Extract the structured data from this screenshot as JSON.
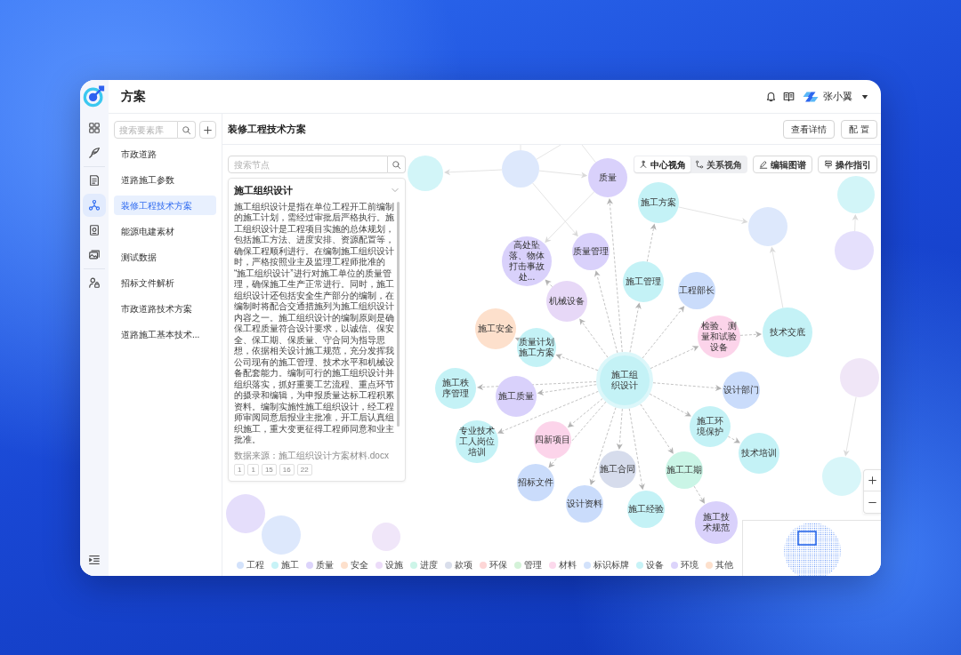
{
  "app": {
    "title": "方案",
    "username": "张小翼"
  },
  "rail": {
    "groups": [
      {
        "items": [
          {
            "selected": false
          },
          {
            "selected": false
          }
        ]
      },
      {
        "items": [
          {
            "selected": false
          },
          {
            "selected": true
          },
          {
            "selected": false
          },
          {
            "selected": false
          }
        ]
      },
      {
        "items": [
          {
            "selected": false
          }
        ]
      }
    ]
  },
  "sidebar": {
    "search": {
      "placeholder": "搜索要素库"
    },
    "items": [
      {
        "label": "市政道路",
        "selected": false
      },
      {
        "label": "道路施工参数",
        "selected": false
      },
      {
        "label": "装修工程技术方案",
        "selected": true
      },
      {
        "label": "能源电建素材",
        "selected": false
      },
      {
        "label": "测试数据",
        "selected": false
      },
      {
        "label": "招标文件解析",
        "selected": false
      },
      {
        "label": "市政道路技术方案",
        "selected": false
      },
      {
        "label": "道路施工基本技术...",
        "selected": false
      }
    ]
  },
  "main": {
    "title": "装修工程技术方案",
    "buttons": [
      "查看详情",
      "配 置"
    ]
  },
  "node_search": {
    "placeholder": "搜索节点"
  },
  "detail": {
    "title": "施工组织设计",
    "text": "施工组织设计是指在单位工程开工前编制的施工计划，需经过审批后严格执行。施工组织设计是工程项目实施的总体规划，包括施工方法、进度安排、资源配置等，确保工程顺利进行。在编制施工组织设计时，严格按照业主及监理工程师批准的“施工组织设计”进行对施工单位的质量管理，确保施工生产正常进行。同时，施工组织设计还包括安全生产部分的编制，在编制时将配合交通措施列为施工组织设计内容之一。施工组织设计的编制原则是确保工程质量符合设计要求，以诚信、保安全、保工期、保质量、守合同为指导思想，依据相关设计施工规范，充分发挥我公司现有的施工管理、技术水平和机械设备配套能力。编制可行的施工组织设计并组织落实，抓好重要工艺流程、重点环节的摄录和编辑，为申报质量达标工程积累资料。编制实施性施工组织设计，经工程师审阅同意后报业主批准，开工后认真组织施工，重大变更征得工程师同意和业主批准。",
    "source": "数据来源：施工组织设计方案材料.docx",
    "pages": [
      "1",
      "1",
      "15",
      "16",
      "22"
    ]
  },
  "view_tabs": [
    {
      "label": "中心视角",
      "selected": true
    },
    {
      "label": "关系视角",
      "selected": false
    }
  ],
  "tools": [
    "编辑图谱",
    "操作指引"
  ],
  "graph": {
    "center_node": {
      "label": "施工组织设计",
      "color": "#c4f2f6",
      "selected": true,
      "children": [
        {
          "label": "质量",
          "color": "#d9d1fb",
          "selected": false
        },
        {
          "label": "质量管理",
          "color": "#d9d1fb",
          "selected": false
        },
        {
          "label": "机械设备",
          "color": "#e7d8f7",
          "selected": false,
          "children": [
            {
              "label": "高处坠落、物体打击事故处...",
              "color": "#d9d1fb",
              "selected": false
            }
          ]
        },
        {
          "label": "施工管理",
          "color": "#c4f2f6",
          "selected": false,
          "children": [
            {
              "label": "施工方案",
              "color": "#c4f2f6",
              "selected": false
            }
          ]
        },
        {
          "label": "工程部长",
          "color": "#cadcfb",
          "selected": false
        },
        {
          "label": "质量计划施工方案",
          "color": "#c4f2f6",
          "selected": false,
          "children": [
            {
              "label": "施工安全",
              "color": "#fde0cc",
              "selected": false
            }
          ]
        },
        {
          "label": "检验、测量和试验设备",
          "color": "#fcd4ea",
          "selected": false,
          "children": [
            {
              "label": "技术交底",
              "color": "#c4f2f6",
              "selected": false
            }
          ]
        },
        {
          "label": "施工秩序管理",
          "color": "#c4f2f6",
          "selected": false
        },
        {
          "label": "施工质量",
          "color": "#d9d1fb",
          "selected": false
        },
        {
          "label": "设计部门",
          "color": "#cadcfb",
          "selected": false
        },
        {
          "label": "专业技术工人岗位培训",
          "color": "#c4f2f6",
          "selected": false
        },
        {
          "label": "四新项目",
          "color": "#fcd4ea",
          "selected": false
        },
        {
          "label": "施工环境保护",
          "color": "#c4f2f6",
          "selected": false,
          "children": [
            {
              "label": "技术培训",
              "color": "#c4f2f6",
              "selected": false
            }
          ]
        },
        {
          "label": "施工合同",
          "color": "#d6dcec",
          "selected": false
        },
        {
          "label": "施工工期",
          "color": "#caf5e6",
          "selected": false,
          "children": [
            {
              "label": "施工技术规范",
              "color": "#d9d1fb",
              "selected": false
            }
          ]
        },
        {
          "label": "招标文件",
          "color": "#cadcfb",
          "selected": false
        },
        {
          "label": "设计资料",
          "color": "#cadcfb",
          "selected": false
        },
        {
          "label": "施工经验",
          "color": "#c4f2f6",
          "selected": false
        }
      ]
    },
    "background_nodes": [
      {
        "color": "#d2f5f8"
      },
      {
        "color": "#dde8fc"
      },
      {
        "color": "#d2f5f8"
      },
      {
        "color": "#dde8fc"
      },
      {
        "color": "#e5e0fc"
      },
      {
        "color": "#f0e6f7"
      },
      {
        "color": "#d8f6f9"
      },
      {
        "color": "#e5defb"
      },
      {
        "color": "#dde8fc"
      },
      {
        "color": "#f0e6f9"
      }
    ]
  },
  "legend": [
    {
      "label": "工程",
      "color": "#d3e2fb"
    },
    {
      "label": "施工",
      "color": "#c7f3f7"
    },
    {
      "label": "质量",
      "color": "#dcd4fb"
    },
    {
      "label": "安全",
      "color": "#fde0cc"
    },
    {
      "label": "设施",
      "color": "#ecdcf9"
    },
    {
      "label": "进度",
      "color": "#cdf5e8"
    },
    {
      "label": "款项",
      "color": "#d9deeb"
    },
    {
      "label": "环保",
      "color": "#fdd6d6"
    },
    {
      "label": "管理",
      "color": "#d4f2d8"
    },
    {
      "label": "材料",
      "color": "#fcd9ec"
    },
    {
      "label": "标识标牌",
      "color": "#d3e2fb"
    },
    {
      "label": "设备",
      "color": "#c7f3f7"
    },
    {
      "label": "环境",
      "color": "#dcd4fb"
    },
    {
      "label": "其他",
      "color": "#fde0cc"
    }
  ]
}
